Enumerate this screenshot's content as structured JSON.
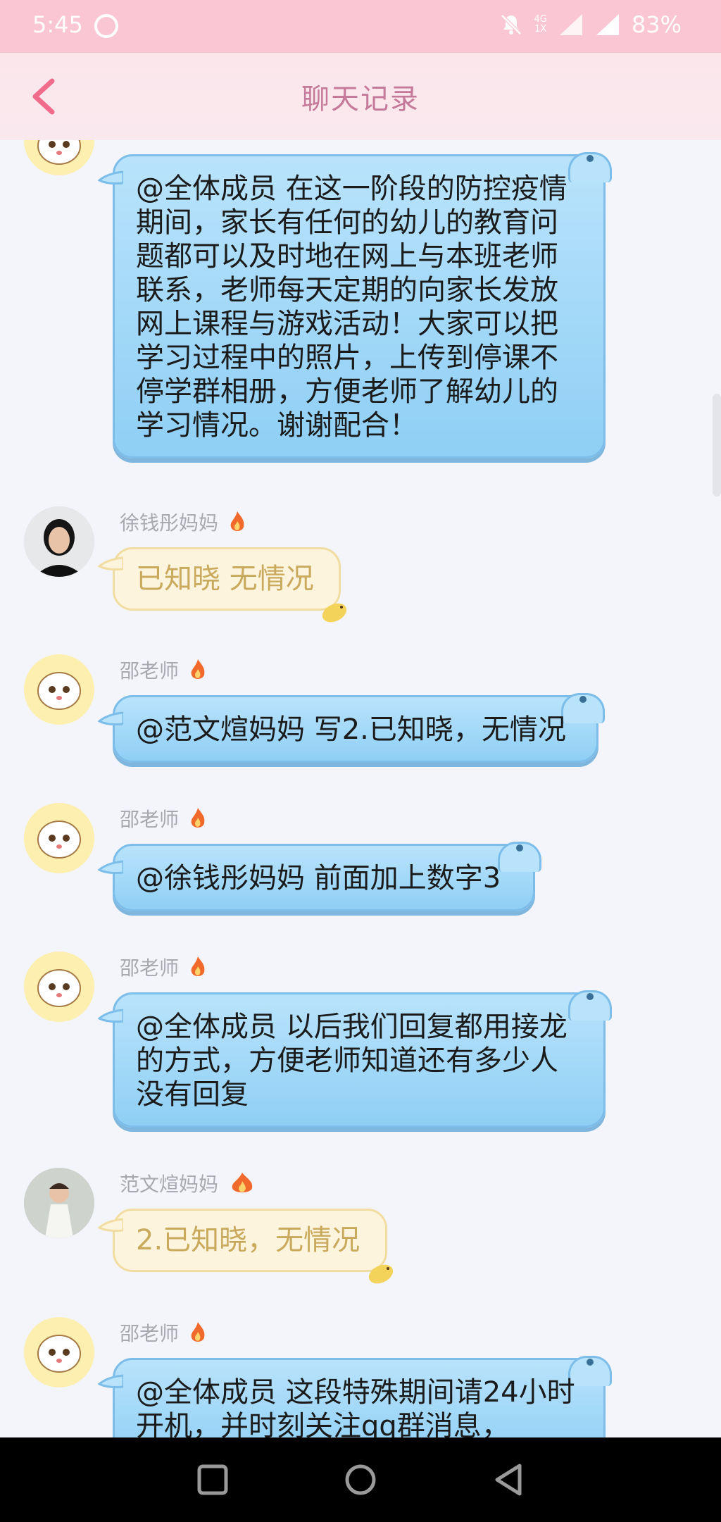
{
  "status_bar": {
    "time": "5:45",
    "network_top": "4G",
    "network_bottom": "1X",
    "battery": "83%"
  },
  "header": {
    "title": "聊天记录"
  },
  "messages": [
    {
      "sender": "",
      "text": "@全体成员 在这一阶段的防控疫情期间，家长有任何的幼儿的教育问题都可以及时地在网上与本班老师联系，老师每天定期的向家长发放网上课程与游戏活动！大家可以把学习过程中的照片，上传到停课不停学群相册，方便老师了解幼儿的学习情况。谢谢配合！"
    },
    {
      "sender": "徐钱彤妈妈",
      "text": "已知晓 无情况"
    },
    {
      "sender": "邵老师",
      "text": "@范文煊妈妈 写2.已知晓，无情况"
    },
    {
      "sender": "邵老师",
      "text": "@徐钱彤妈妈 前面加上数字3"
    },
    {
      "sender": "邵老师",
      "text": "@全体成员 以后我们回复都用接龙的方式，方便老师知道还有多少人没有回复"
    },
    {
      "sender": "范文煊妈妈",
      "text": "2.已知晓，无情况"
    },
    {
      "sender": "邵老师",
      "text": "@全体成员 这段特殊期间请24小时开机，并时刻关注qq群消息，"
    }
  ],
  "colors": {
    "status_bar": "#fbc6d3",
    "header_title": "#c47a98",
    "blue_bubble": "#9dd6f7",
    "yellow_bubble": "#fdf4dd",
    "yellow_text": "#c9a95c"
  },
  "icons": {
    "back": "chevron-left-icon",
    "mute": "bell-off-icon",
    "signal": "signal-icon",
    "fire": "fire-icon",
    "bird": "bird-icon"
  }
}
